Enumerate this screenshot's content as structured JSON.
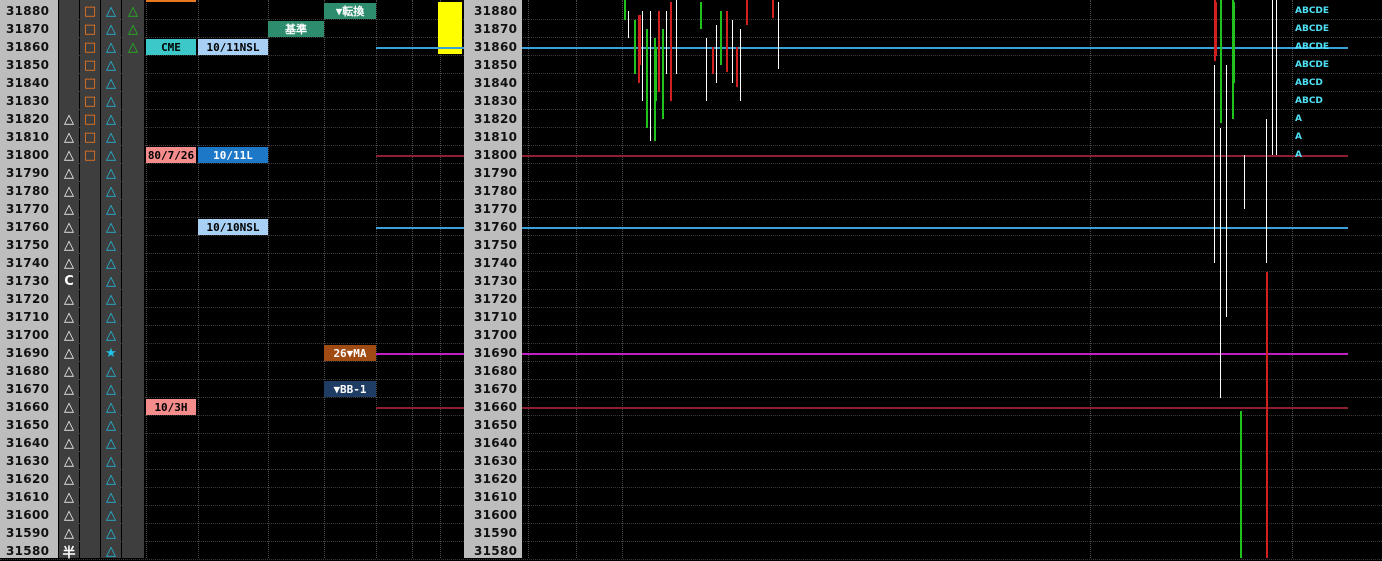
{
  "prices": [
    31880,
    31870,
    31860,
    31850,
    31840,
    31830,
    31820,
    31810,
    31800,
    31790,
    31780,
    31770,
    31760,
    31750,
    31740,
    31730,
    31720,
    31710,
    31700,
    31690,
    31680,
    31670,
    31660,
    31650,
    31640,
    31630,
    31620,
    31610,
    31600,
    31590,
    31580
  ],
  "marks": {
    "col1": {
      "31820": "△",
      "31810": "△",
      "31800": "△",
      "31790": "△",
      "31780": "△",
      "31770": "△",
      "31760": "△",
      "31750": "△",
      "31740": "△",
      "31730": "C",
      "31720": "△",
      "31710": "△",
      "31700": "△",
      "31690": "△",
      "31680": "△",
      "31670": "△",
      "31660": "△",
      "31650": "△",
      "31640": "△",
      "31630": "△",
      "31620": "△",
      "31610": "△",
      "31600": "△",
      "31590": "△",
      "31580": "半"
    },
    "col2": {
      "31880": "□",
      "31870": "□",
      "31860": "□",
      "31850": "□",
      "31840": "□",
      "31830": "□",
      "31820": "□",
      "31810": "□",
      "31800": "□"
    },
    "col3": {
      "31690": "★"
    },
    "col4": {
      "31880": "△",
      "31870": "△",
      "31860": "△"
    }
  },
  "labels": [
    {
      "price": 31860,
      "col": "a",
      "text": "CME",
      "bg": "#3cc8c8",
      "fg": "#000000"
    },
    {
      "price": 31800,
      "col": "a",
      "text": "80/7/26",
      "bg": "#f48c8c",
      "fg": "#000000"
    },
    {
      "price": 31660,
      "col": "a",
      "text": "10/3H",
      "bg": "#f48c8c",
      "fg": "#000000"
    },
    {
      "price": 31860,
      "col": "b",
      "text": "10/11NSL",
      "bg": "#a8d0f4",
      "fg": "#000000"
    },
    {
      "price": 31800,
      "col": "b",
      "text": "10/11L",
      "bg": "#1e78c8",
      "fg": "#ffffff"
    },
    {
      "price": 31760,
      "col": "b",
      "text": "10/10NSL",
      "bg": "#a8d0f4",
      "fg": "#000000"
    },
    {
      "price": 31870,
      "col": "c",
      "text": "基準",
      "bg": "#2e8c6e",
      "fg": "#ffffff"
    },
    {
      "price": 31880,
      "col": "d",
      "text": "▼転換",
      "bg": "#2e8c6e",
      "fg": "#ffffff"
    },
    {
      "price": 31690,
      "col": "d",
      "text": "26▼MA",
      "bg": "#a04a14",
      "fg": "#ffffff"
    },
    {
      "price": 31670,
      "col": "d",
      "text": "▼BB-1",
      "bg": "#1e3c64",
      "fg": "#ffffff"
    }
  ],
  "tpo_letters": {
    "31880": "ABCDE",
    "31870": "ABCDE",
    "31860": "ABCDE",
    "31850": "ABCDE",
    "31840": "ABCD",
    "31830": "ABCD",
    "31820": "A",
    "31810": "A",
    "31800": "A"
  },
  "levels": [
    {
      "price": 31860,
      "color": "#3aa0d8"
    },
    {
      "price": 31800,
      "color": "#3aa0d8"
    },
    {
      "price": 31800,
      "color": "#8c2030"
    },
    {
      "price": 31760,
      "color": "#3aa0d8"
    },
    {
      "price": 31690,
      "color": "#c020c0"
    },
    {
      "price": 31660,
      "color": "#8c2030"
    }
  ],
  "colors": {
    "up": "#21c21e",
    "down": "#d02020",
    "neutral": "#ffffff",
    "current_price_marker": "#ffff00",
    "tpo_text": "#4fe2f6"
  }
}
